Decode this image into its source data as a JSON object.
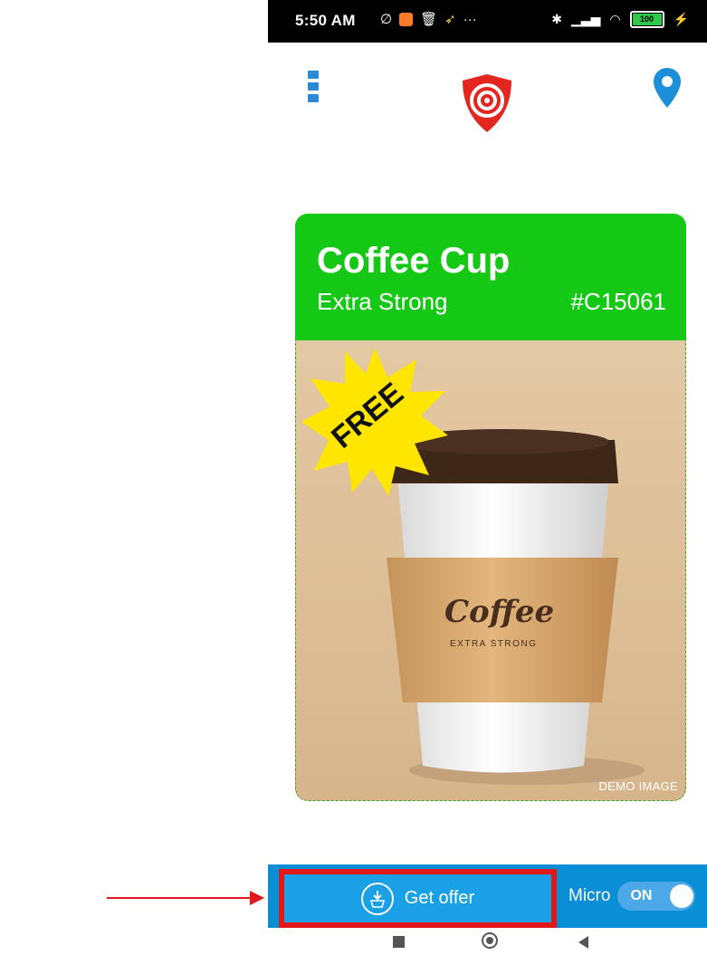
{
  "status_bar": {
    "time": "5:50 AM",
    "notifications": "···",
    "battery_level": "100"
  },
  "header": {
    "menu_icon": "menu-icon",
    "logo_icon": "shield-target-logo",
    "location_icon": "location-pin-icon",
    "accent_color": "#2a8ad6"
  },
  "offer_card": {
    "title": "Coffee Cup",
    "subtitle": "Extra Strong",
    "code": "#C15061",
    "badge": "FREE",
    "cup_label": "Coffee",
    "cup_sublabel": "EXTRA STRONG",
    "demo_label": "DEMO IMAGE",
    "header_color": "#16c816"
  },
  "bottom_bar": {
    "get_offer_label": "Get offer",
    "micro_label": "Micro",
    "toggle_label": "ON",
    "toggle_state": true,
    "bar_color": "#0a8fd6"
  },
  "nav_bar": {
    "recent_icon": "square-icon",
    "home_icon": "circle-icon",
    "back_icon": "triangle-back-icon"
  }
}
